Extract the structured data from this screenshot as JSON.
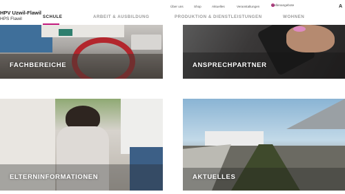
{
  "brand": {
    "name": "HPV Uzwil-Flawil",
    "sub": "HPS Flawil"
  },
  "utility_nav": {
    "item1": "Über uns",
    "item2": "Shop",
    "item3": "Aktuelles",
    "item4": "Veranstaltungen",
    "item5": "Stellenangebote",
    "item5_badge": "J",
    "item6": "A"
  },
  "main_nav": {
    "item1": "SCHULE",
    "item2": "ARBEIT & AUSBILDUNG",
    "item3": "PRODUKTION & DIENSTLEISTUNGEN",
    "item4": "WOHNEN",
    "active_color": "#c2187c"
  },
  "tiles": {
    "t1": "FACHBEREICHE",
    "t2": "ANSPRECHPARTNER",
    "t3": "ELTERNINFORMATIONEN",
    "t4": "AKTUELLES"
  }
}
